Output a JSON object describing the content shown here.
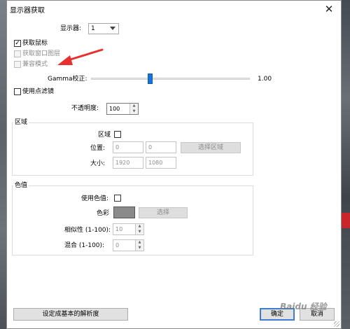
{
  "window": {
    "title": "显示器获取",
    "close_glyph": "✕"
  },
  "display": {
    "label": "显示器:",
    "value": "1"
  },
  "options": {
    "capture_cursor": {
      "label": "获取鼠标",
      "checked": true,
      "check_glyph": "✓"
    },
    "capture_layered": {
      "label": "获取窗口图层",
      "checked": false
    },
    "compat_mode": {
      "label": "兼容模式",
      "checked": false
    }
  },
  "gamma": {
    "label": "Gamma校正:",
    "value": "1.00",
    "level": 0.37
  },
  "point_filter": {
    "label": "使用点滤镜",
    "checked": false
  },
  "opacity": {
    "label": "不透明度:",
    "value": "100",
    "up_glyph": "▲",
    "down_glyph": "▼"
  },
  "region": {
    "group_title": "区域",
    "enable_label": "区域",
    "position_label": "位置:",
    "pos_x": "0",
    "pos_y": "0",
    "select_button": "选择区域",
    "size_label": "大小:",
    "width": "1920",
    "height": "1080"
  },
  "color_key": {
    "group_title": "色值",
    "use_label": "使用色值:",
    "color_label": "色彩",
    "color_value": "#8a8a8a",
    "select_button": "选择",
    "similarity_label": "相似性 (1-100):",
    "similarity_value": "10",
    "blend_label": "混合 (1-100):",
    "blend_value": "0"
  },
  "footer": {
    "set_resolution_button": "设定成基本的解析度",
    "ok_button": "确定",
    "cancel_button": "取消"
  },
  "watermark": "Baidu 经验",
  "colors": {
    "accent": "#1a73d4",
    "annotation_arrow": "#e8312f"
  }
}
